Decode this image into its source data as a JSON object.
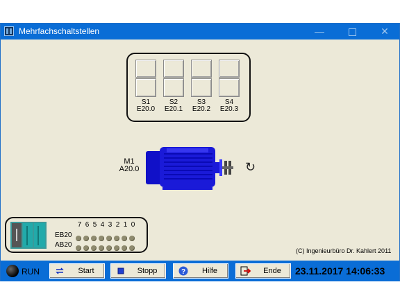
{
  "window": {
    "title": "Mehrfachschaltstellen"
  },
  "switches": [
    {
      "name": "S1",
      "address": "E20.0"
    },
    {
      "name": "S2",
      "address": "E20.1"
    },
    {
      "name": "S3",
      "address": "E20.2"
    },
    {
      "name": "S4",
      "address": "E20.3"
    }
  ],
  "motor": {
    "name": "M1",
    "address": "A20.0",
    "rotation_icon": "rotate-icon"
  },
  "io": {
    "bit_labels": [
      "7",
      "6",
      "5",
      "4",
      "3",
      "2",
      "1",
      "0"
    ],
    "input_label": "EB20",
    "output_label": "AB20",
    "input_bits": [
      0,
      0,
      0,
      0,
      0,
      0,
      0,
      0
    ],
    "output_bits": [
      0,
      0,
      0,
      0,
      0,
      0,
      0,
      0
    ]
  },
  "copyright": "(C) Ingenieurbüro Dr. Kahlert 2011",
  "status": {
    "run_label": "RUN"
  },
  "buttons": {
    "start": "Start",
    "stop": "Stopp",
    "help": "Hilfe",
    "end": "Ende"
  },
  "datetime": "23.11.2017  14:06:33",
  "colors": {
    "titlebar": "#0a6dd6",
    "background": "#ece9d8",
    "motor": "#1a1ad8"
  }
}
